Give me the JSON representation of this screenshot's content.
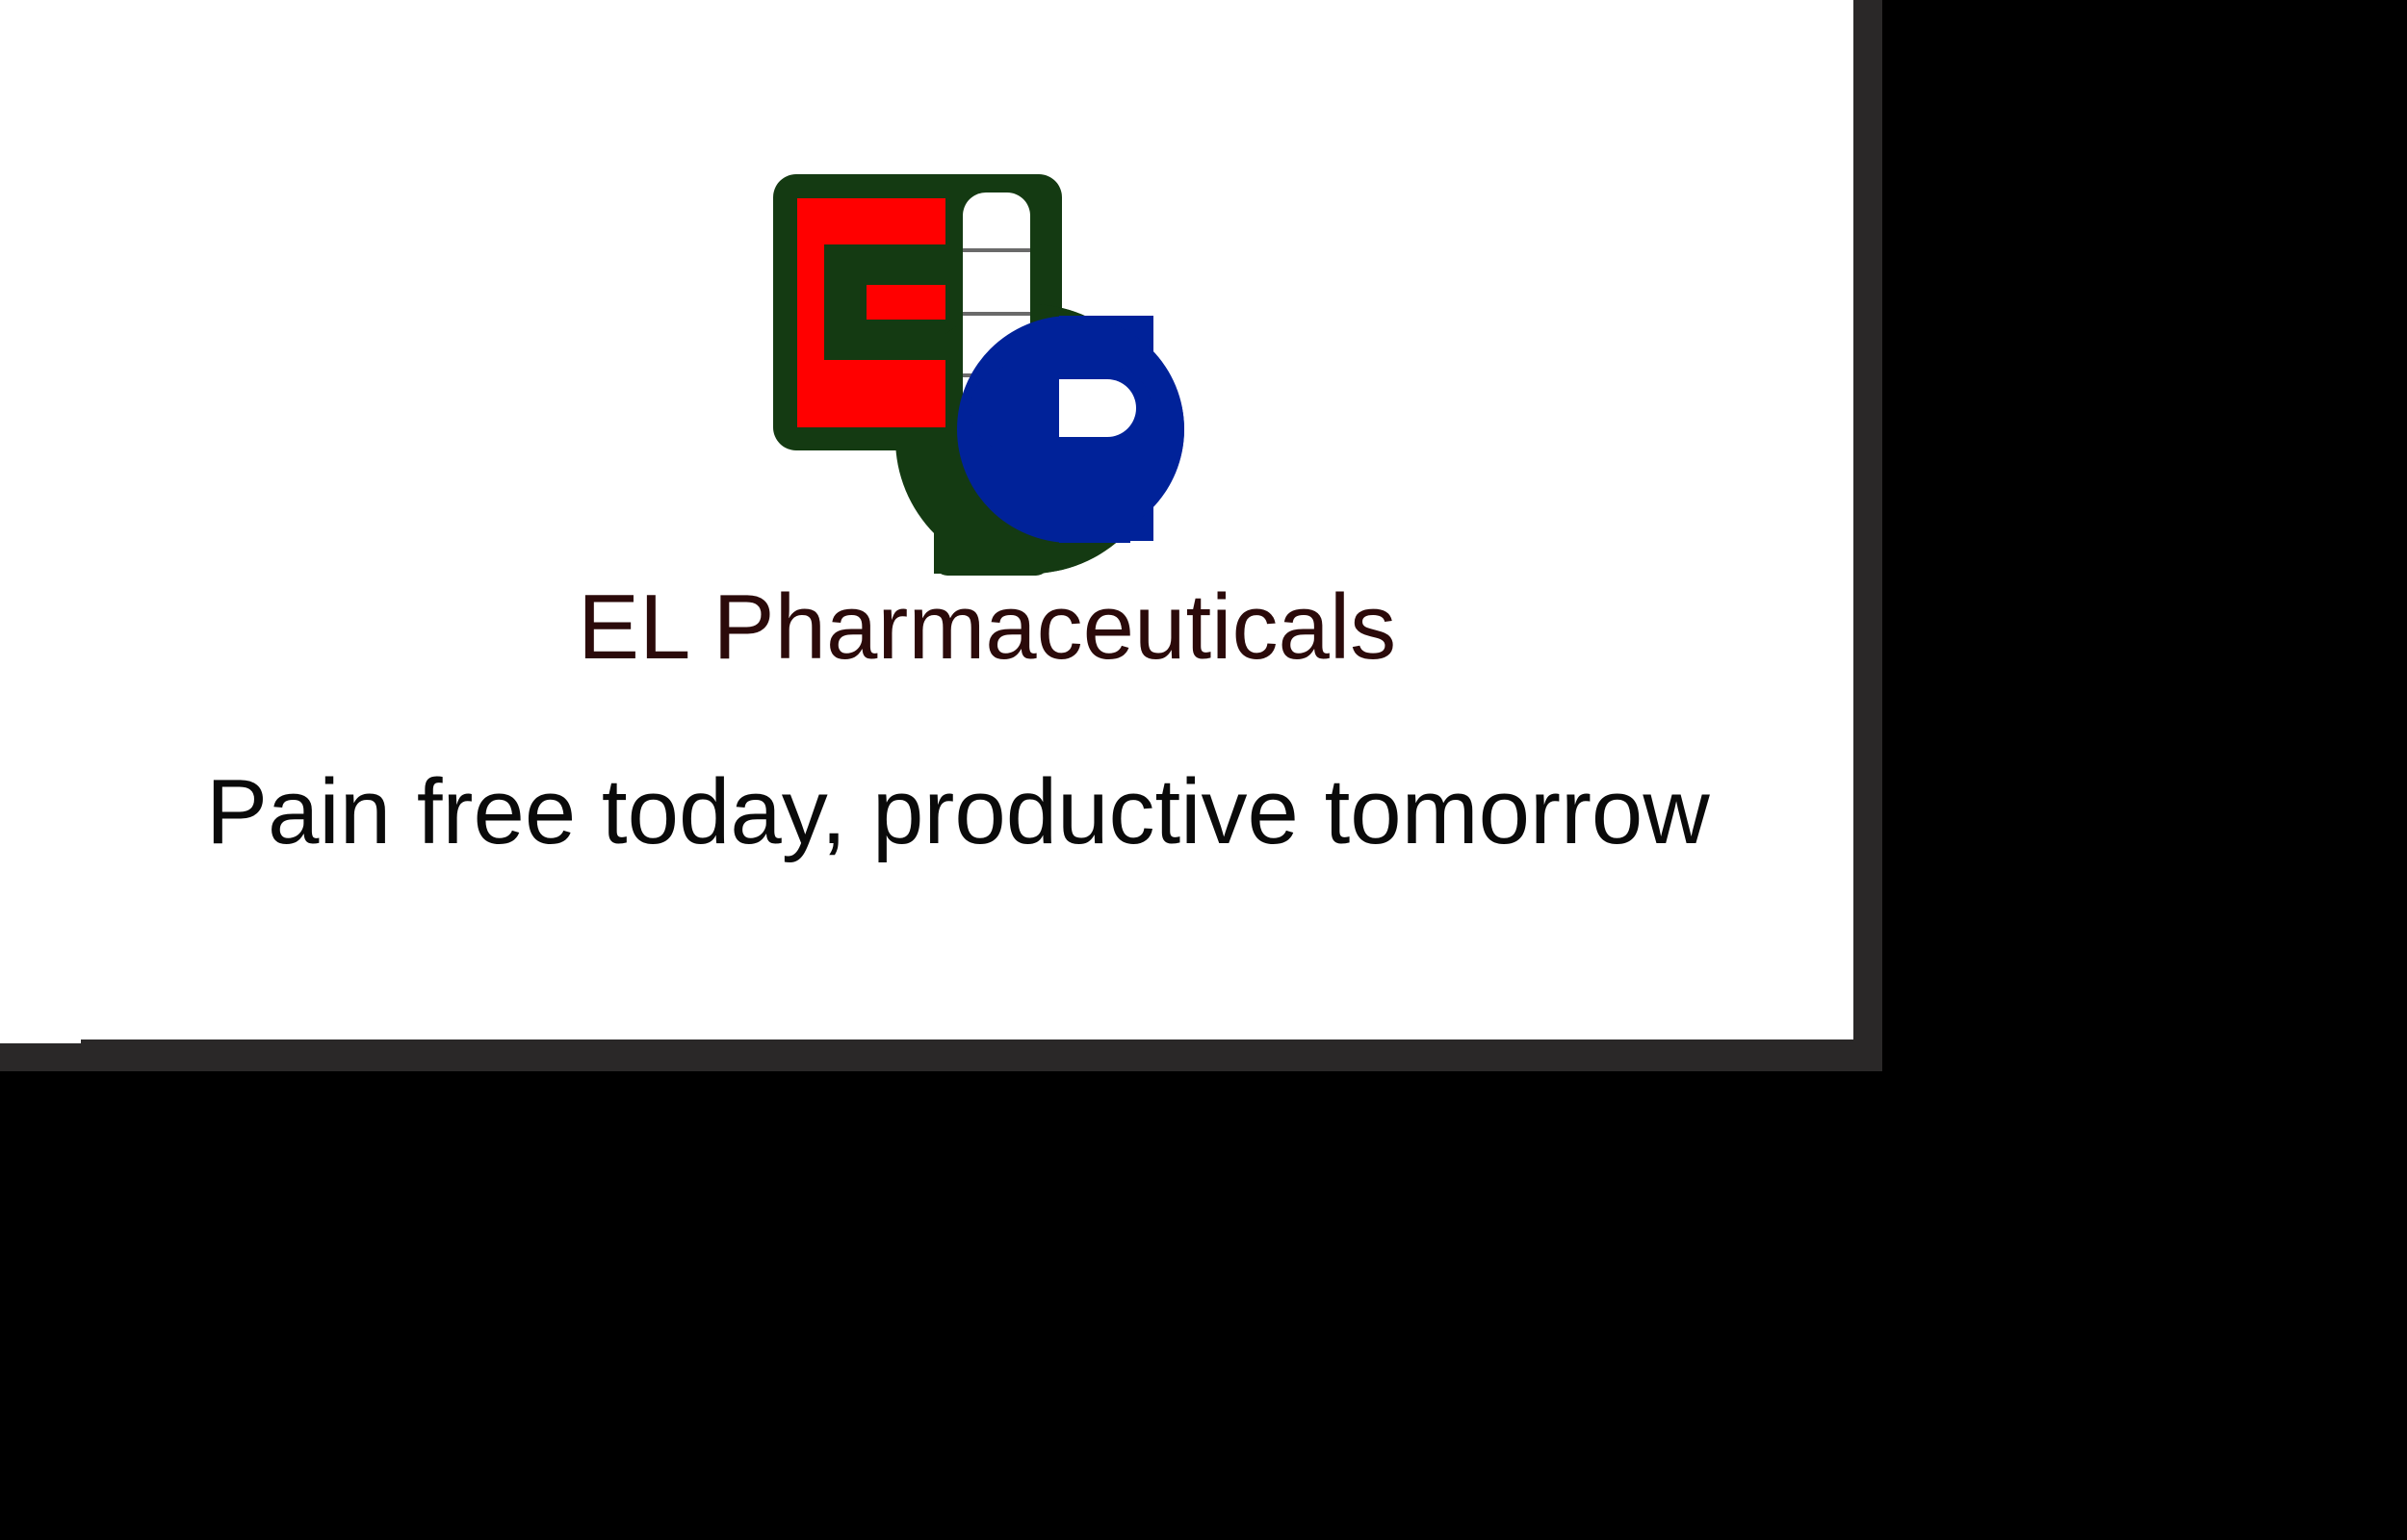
{
  "brand": {
    "logo_name": "ep-logo",
    "logo_letters": "EP",
    "name": "EL Pharmaceuticals",
    "tagline": "Pain free today, productive tomorrow"
  },
  "colors": {
    "background": "#000000",
    "card": "#ffffff",
    "frame_shadow": "#2a2828",
    "logo_outline": "#143a12",
    "logo_red": "#ff0000",
    "logo_blue": "#002299",
    "logo_white": "#ffffff",
    "brand_text": "#2b0a0a",
    "tagline_text": "#0a0a0a"
  }
}
